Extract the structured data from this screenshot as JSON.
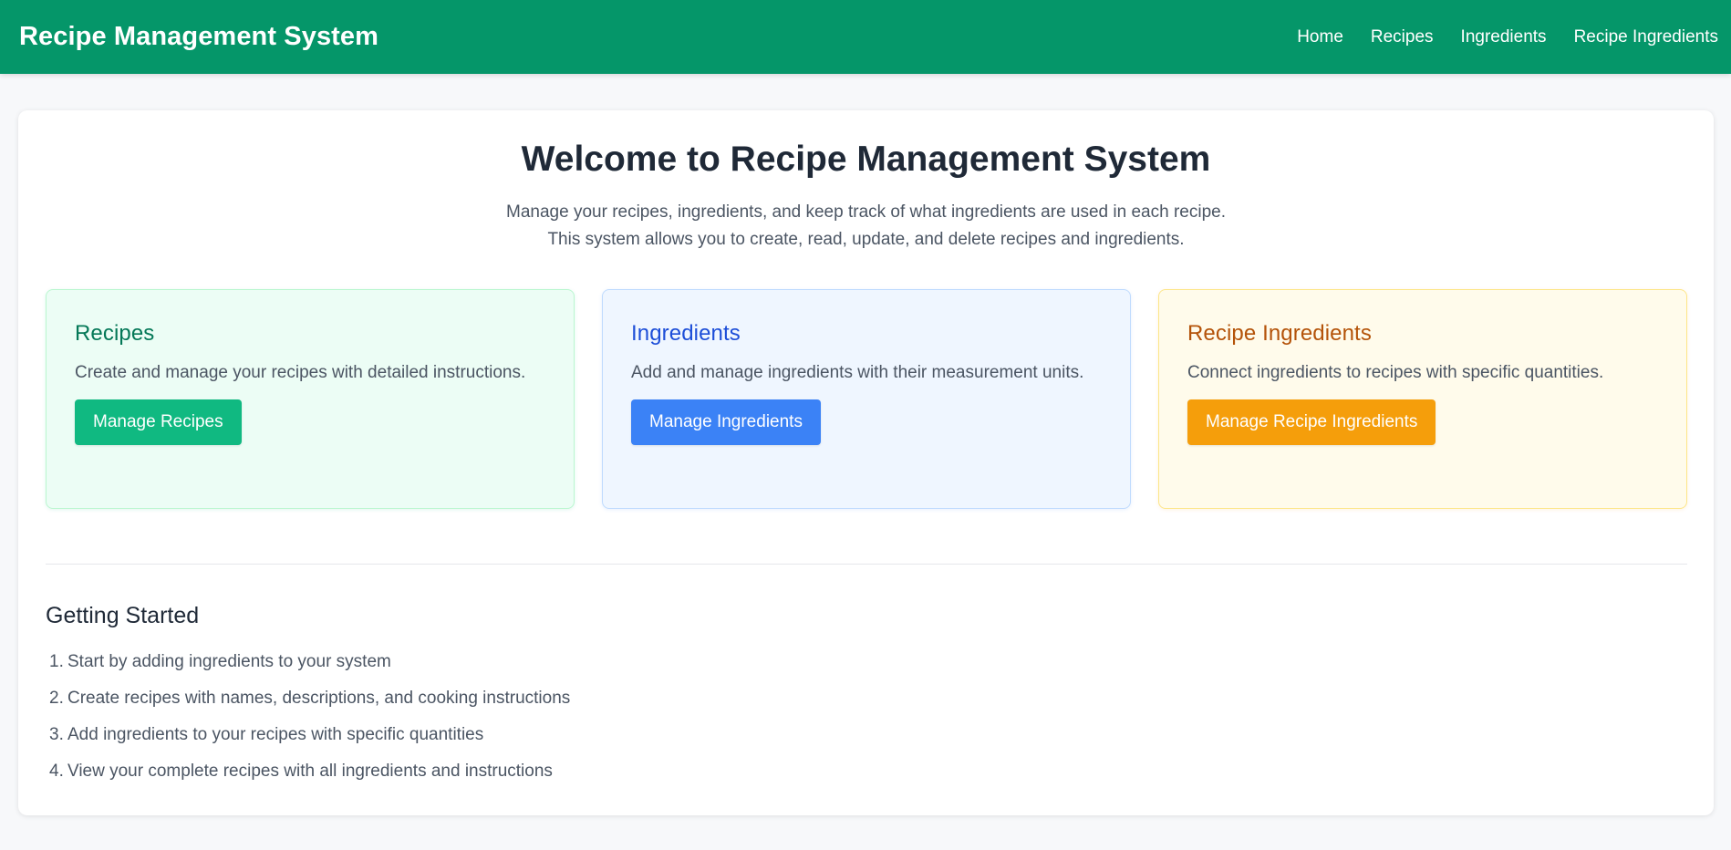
{
  "header": {
    "title": "Recipe Management System",
    "nav": [
      {
        "label": "Home"
      },
      {
        "label": "Recipes"
      },
      {
        "label": "Ingredients"
      },
      {
        "label": "Recipe Ingredients"
      }
    ]
  },
  "hero": {
    "title": "Welcome to Recipe Management System",
    "subtitle_line1": "Manage your recipes, ingredients, and keep track of what ingredients are used in each recipe.",
    "subtitle_line2": "This system allows you to create, read, update, and delete recipes and ingredients."
  },
  "cards": [
    {
      "title": "Recipes",
      "description": "Create and manage your recipes with detailed instructions.",
      "button": "Manage Recipes",
      "color": "#10b981"
    },
    {
      "title": "Ingredients",
      "description": "Add and manage ingredients with their measurement units.",
      "button": "Manage Ingredients",
      "color": "#3b82f6"
    },
    {
      "title": "Recipe Ingredients",
      "description": "Connect ingredients to recipes with specific quantities.",
      "button": "Manage Recipe Ingredients",
      "color": "#f59e0b"
    }
  ],
  "getting_started": {
    "title": "Getting Started",
    "steps": [
      {
        "num": "1.",
        "text": "Start by adding ingredients to your system"
      },
      {
        "num": "2.",
        "text": "Create recipes with names, descriptions, and cooking instructions"
      },
      {
        "num": "3.",
        "text": "Add ingredients to your recipes with specific quantities"
      },
      {
        "num": "4.",
        "text": "View your complete recipes with all ingredients and instructions"
      }
    ]
  },
  "theme": {
    "primary": "#059669",
    "background": "#f7f8fa"
  }
}
